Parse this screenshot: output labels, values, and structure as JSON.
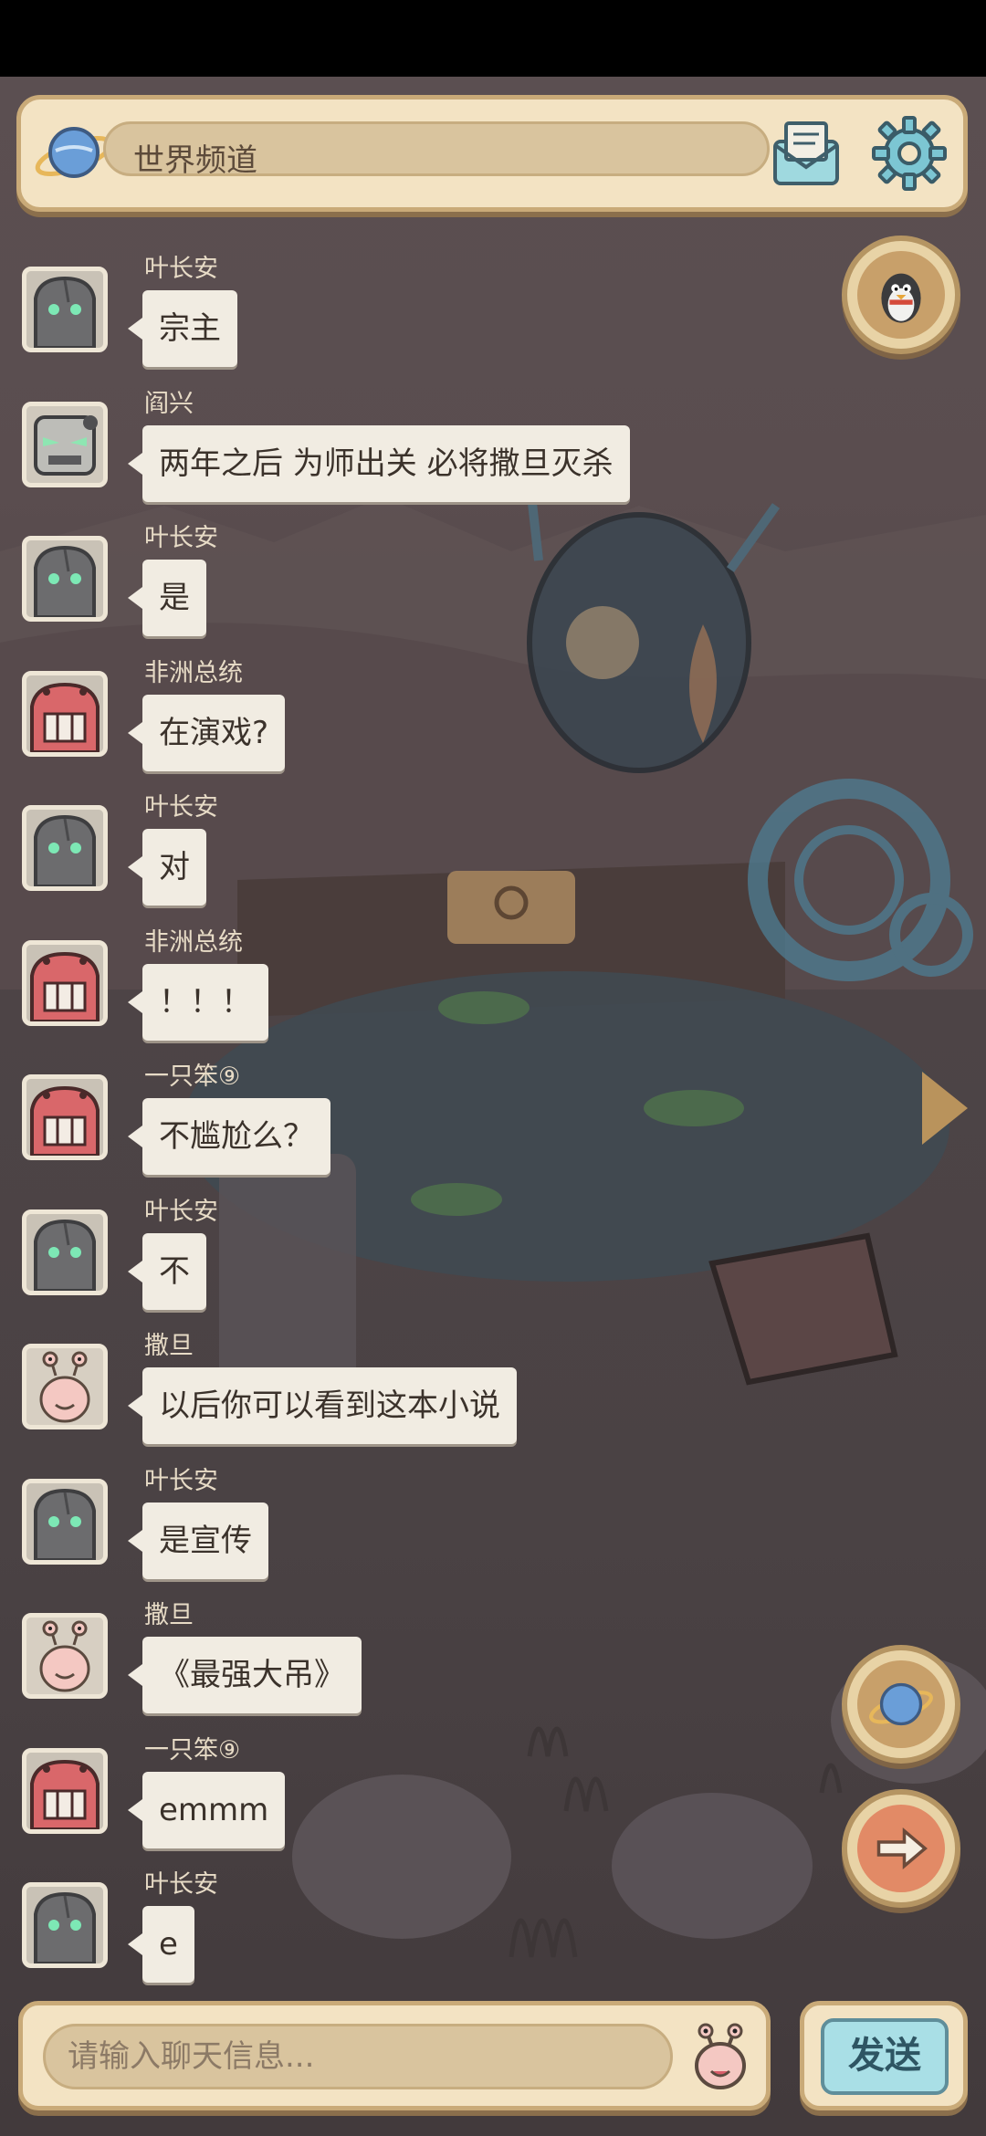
{
  "header": {
    "channel_title": "世界频道"
  },
  "messages": [
    {
      "name": "叶长安",
      "text": "宗主",
      "avatar": "stone-golem"
    },
    {
      "name": "阎兴",
      "text": "两年之后  为师出关  必将撒旦灭杀",
      "avatar": "robot-mask"
    },
    {
      "name": "叶长安",
      "text": "是",
      "avatar": "stone-golem"
    },
    {
      "name": "非洲总统",
      "text": "在演戏?",
      "avatar": "red-crab"
    },
    {
      "name": "叶长安",
      "text": "对",
      "avatar": "stone-golem"
    },
    {
      "name": "非洲总统",
      "text": "！！！",
      "avatar": "red-crab"
    },
    {
      "name": "一只笨⑨",
      "text": "不尴尬么？",
      "avatar": "red-crab"
    },
    {
      "name": "叶长安",
      "text": "不",
      "avatar": "stone-golem"
    },
    {
      "name": "撒旦",
      "text": "以后你可以看到这本小说",
      "avatar": "snail"
    },
    {
      "name": "叶长安",
      "text": "是宣传",
      "avatar": "stone-golem"
    },
    {
      "name": "撒旦",
      "text": "《最强大吊》",
      "avatar": "snail"
    },
    {
      "name": "一只笨⑨",
      "text": "emmm",
      "avatar": "red-crab"
    },
    {
      "name": "叶长安",
      "text": "e",
      "avatar": "stone-golem"
    }
  ],
  "input": {
    "placeholder": "请输入聊天信息..."
  },
  "send_button": {
    "label": "发送"
  },
  "side_buttons": [
    "penguin-icon",
    "planet-icon",
    "arrow-right-icon"
  ],
  "colors": {
    "panel": "#f3e3c3",
    "panel_border": "#c9aa78",
    "send": "#a9dfe6"
  }
}
